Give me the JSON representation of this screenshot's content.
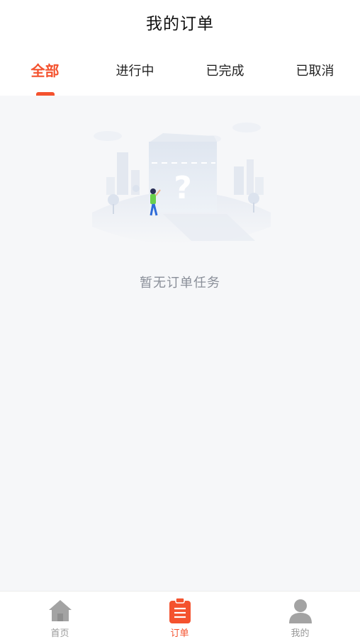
{
  "header": {
    "title": "我的订单"
  },
  "tabs": [
    {
      "label": "全部",
      "active": true
    },
    {
      "label": "进行中",
      "active": false
    },
    {
      "label": "已完成",
      "active": false
    },
    {
      "label": "已取消",
      "active": false
    }
  ],
  "empty_state": {
    "icon": "empty-orders-illustration",
    "message": "暂无订单任务"
  },
  "tabbar": {
    "items": [
      {
        "label": "首页",
        "icon": "home-icon",
        "active": false
      },
      {
        "label": "订单",
        "icon": "order-icon",
        "active": true
      },
      {
        "label": "我的",
        "icon": "user-icon",
        "active": false
      }
    ]
  },
  "colors": {
    "accent": "#f4522e",
    "inactive": "#999999",
    "background": "#f6f7f9"
  }
}
